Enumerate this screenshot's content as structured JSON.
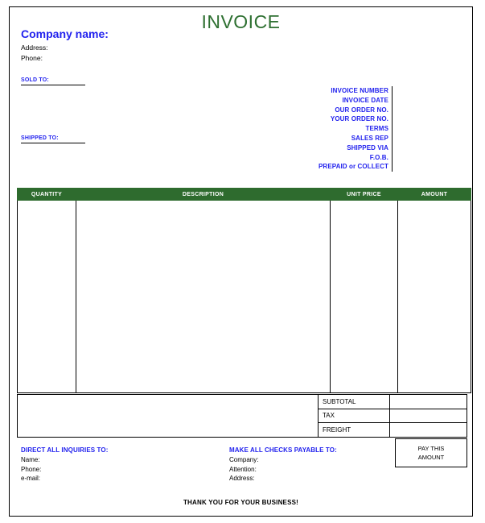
{
  "document": {
    "title": "INVOICE",
    "title_color": "#2e7031",
    "accent_blue": "#2222ee",
    "header_green": "#2e6b2e"
  },
  "company": {
    "name_label": "Company name:",
    "address_label": "Address:",
    "phone_label": "Phone:"
  },
  "parties": {
    "sold_to_label": "SOLD TO:",
    "shipped_to_label": "SHIPPED TO:"
  },
  "meta_fields": [
    "INVOICE NUMBER",
    "INVOICE DATE",
    "OUR ORDER NO.",
    "YOUR ORDER NO.",
    "TERMS",
    "SALES REP",
    "SHIPPED VIA",
    "F.O.B.",
    "PREPAID or COLLECT"
  ],
  "items_table": {
    "columns": [
      "QUANTITY",
      "DESCRIPTION",
      "UNIT PRICE",
      "AMOUNT"
    ],
    "rows": []
  },
  "totals": {
    "rows": [
      {
        "label": "SUBTOTAL",
        "value": ""
      },
      {
        "label": "TAX",
        "value": ""
      },
      {
        "label": "FREIGHT",
        "value": ""
      }
    ]
  },
  "pay_amount": {
    "line1": "PAY THIS",
    "line2": "AMOUNT",
    "value": ""
  },
  "inquiries": {
    "heading": "DIRECT ALL INQUIRIES TO:",
    "lines": [
      "Name:",
      "Phone:",
      "e-mail:"
    ]
  },
  "checks": {
    "heading": "MAKE ALL CHECKS PAYABLE TO:",
    "lines": [
      "Company:",
      "Attention:",
      "Address:"
    ]
  },
  "footer": {
    "thank_you": "THANK YOU FOR YOUR BUSINESS!"
  }
}
